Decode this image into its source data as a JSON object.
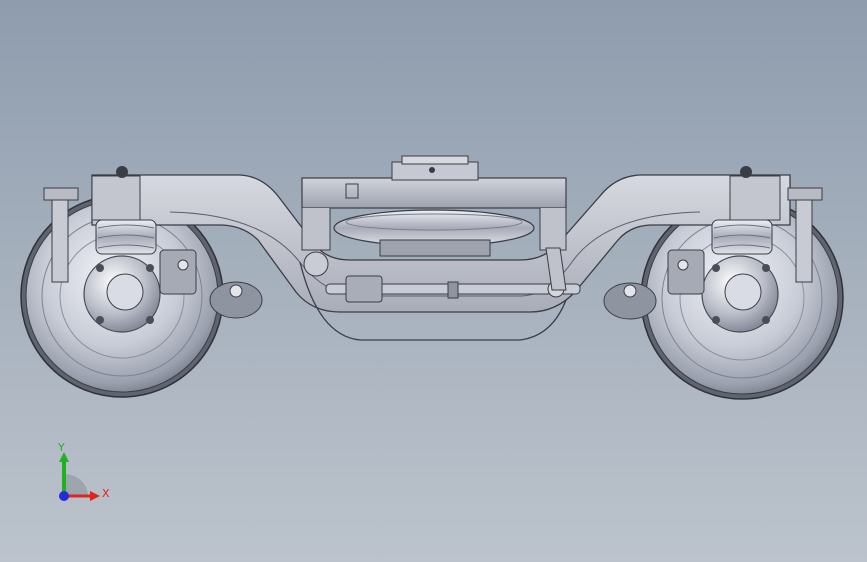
{
  "viewport": {
    "background_top": "#8e9cae",
    "background_bottom": "#bcc3cc"
  },
  "model": {
    "components": [
      "left-wheel",
      "right-wheel",
      "bogie-frame",
      "bolster",
      "air-spring",
      "traction-rod",
      "primary-springs",
      "axle-boxes",
      "brake-units"
    ]
  },
  "triad": {
    "x_label": "X",
    "y_label": "Y",
    "x_color": "#e0241f",
    "y_color": "#21b024",
    "z_color": "#1f2ed8"
  }
}
